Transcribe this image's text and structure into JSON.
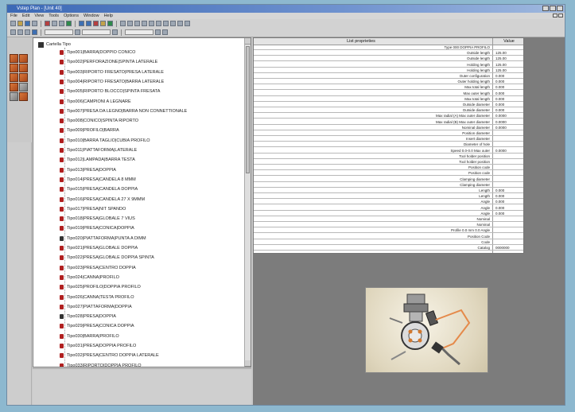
{
  "window": {
    "title": "Vstep Plan - [Unit 40]"
  },
  "menu": [
    "File",
    "Edit",
    "View",
    "Tools",
    "Options",
    "Window",
    "Help"
  ],
  "tree": {
    "root_label": "Cartella Tipo",
    "items": [
      "Tipo001|BARRA|DOPPIO CONICO",
      "Tipo002|PERFORAZIONE|SPINTA LATERALE",
      "Tipo003|RIPORTO FRESATO|PRESA LATERALE",
      "Tipo004|RIPORTO FRESATO|BARRA LATERALE",
      "Tipo005|RIPORTO BLOCCO|SPINTA FRESATA",
      "Tipo006|CAMPIONI A LEGNARE",
      "Tipo007|PRESA DA LEGNO|BARRA NON CONNETTIONALE",
      "Tipo008|CONICO|SPINTA RIPORTO",
      "Tipo009|PROFILO|BARRA",
      "Tipo010|BARRA TAGLIO|CUBIA PROFILO",
      "Tipo011|PIATTAFORMA|LATERALE",
      "Tipo012|LAMPADA|BARRA TESTA",
      "Tipo013|PRESA|DOPPIA",
      "Tipo014|PRESA|CANDELA 8 MMM",
      "Tipo015|PRESA|CANDELA DOPPIA",
      "Tipo016|PRESA|CANDELA 27 X 9MMM",
      "Tipo017|PRESA|NIT SPANDO",
      "Tipo018|PRESA|GLOBALE 7 VIUS",
      "Tipo019|PRESA|CONICA|DOPPIA",
      "Tipo020|PIATTAFORMA|PUNTA A DIMM",
      "Tipo021|PRESA|GLOBALE DOPPIA",
      "Tipo022|PRESA|GLOBALE DOPPIA SPINTA",
      "Tipo023|PRESA|CENTRO DOPPIA",
      "Tipo024|CANNA|PROFILO",
      "Tipo025|PROFILO|DOPPIA PROFILO",
      "Tipo026|CANNA|TESTA PROFILO",
      "Tipo027|PIATTAFORMA|DOPPIA",
      "Tipo028|PRESA|DOPPIA",
      "Tipo029|PRESA|CONICA DOPPIA",
      "Tipo030|BARRA|PROFILO",
      "Tipo031|PRESA|DOPPIA PROFILO",
      "Tipo032|PRESA|CENTRO DOPPIA LATERALE",
      "Tipo033|RIPORTO|DOPPIA PROFILO"
    ]
  },
  "properties": {
    "header_name": "List proprieties",
    "header_value": "Value",
    "rows": [
      {
        "name": "Type 000 DOPPIA PROFILO",
        "value": ""
      },
      {
        "name": "Outside length",
        "value": "125.00"
      },
      {
        "name": "Outside length",
        "value": "125.00"
      },
      {
        "name": "Holding length",
        "value": "125.00"
      },
      {
        "name": "Holding length",
        "value": "125.00"
      },
      {
        "name": "Outer configuration",
        "value": "0.000"
      },
      {
        "name": "Outer holding length",
        "value": "0.000"
      },
      {
        "name": "Max total length",
        "value": "0.000"
      },
      {
        "name": "Max outer length",
        "value": "0.000"
      },
      {
        "name": "Max total length",
        "value": "0.000"
      },
      {
        "name": "Outside diameter",
        "value": "0.000"
      },
      {
        "name": "Outside diameter",
        "value": "0.000"
      },
      {
        "name": "Max radial (A) Max outer diameter",
        "value": "0.0000"
      },
      {
        "name": "Max radial (B) Max outer diameter",
        "value": "0.0000"
      },
      {
        "name": "Nominal diameter",
        "value": "0.0000"
      },
      {
        "name": "Position diameter",
        "value": ""
      },
      {
        "name": "Insert diameter",
        "value": ""
      },
      {
        "name": "Diameter of hole",
        "value": ""
      },
      {
        "name": "Speed 0.0-0.0 Max outer",
        "value": "0.0000"
      },
      {
        "name": "Tool holder position",
        "value": ""
      },
      {
        "name": "Tool holder position",
        "value": ""
      },
      {
        "name": "Position code",
        "value": ""
      },
      {
        "name": "Position code",
        "value": ""
      },
      {
        "name": "Clamping diameter",
        "value": ""
      },
      {
        "name": "Clamping diameter",
        "value": ""
      },
      {
        "name": "Length",
        "value": "0.000"
      },
      {
        "name": "Length",
        "value": "0.000"
      },
      {
        "name": "Angle",
        "value": "0.000"
      },
      {
        "name": "Angle",
        "value": "0.000"
      },
      {
        "name": "Angle",
        "value": "0.000"
      },
      {
        "name": "Nominal",
        "value": ""
      },
      {
        "name": "Nominal",
        "value": ""
      },
      {
        "name": "Profile 0.0 mm 0.0 Angle",
        "value": ""
      },
      {
        "name": "Position Code",
        "value": ""
      },
      {
        "name": "Code",
        "value": ""
      },
      {
        "name": "Catalog",
        "value": "0000000"
      }
    ]
  },
  "colors": {
    "desktop": "#8db8cf",
    "accent_tool": "#d9763a",
    "node_icon": "#b02020"
  }
}
